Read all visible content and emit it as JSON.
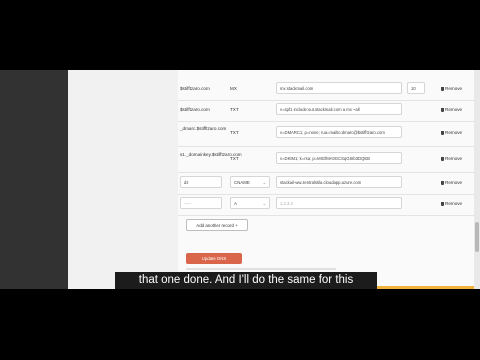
{
  "records": [
    {
      "host": "$stifftzaro.com",
      "type": "MX",
      "value": "mx.stackmail.com",
      "priority": "10",
      "remove": "Remove"
    },
    {
      "host": "$stifftzaro.com",
      "type": "TXT",
      "value": "v=spf1 include:out.stackmail.com a mx ~all",
      "remove": "Remove"
    },
    {
      "host": "_dmarc.$stifftzaro.com",
      "type": "TXT",
      "value": "v=DMARC1; p=none; rua=mailto:dmarc@$stifftzaro.com",
      "remove": "Remove"
    },
    {
      "host": "s1._domainkey.$stifftzaro.com",
      "type": "TXT",
      "value": "v=DKIM1; k=rsa; p=MIGfMA0GCSqGSIb3DQEB",
      "remove": "Remove"
    },
    {
      "host": "dz",
      "type": "CNAME",
      "value": "stackail-ww.zentralstila.cloudapp.azure.com",
      "remove": "Remove"
    },
    {
      "host": "-----",
      "type": "A",
      "value": "1.2.3.4",
      "remove": "Remove"
    }
  ],
  "add_record_label": "Add another record",
  "update_label": "Update DNS",
  "subtitle": "that one done. And I'll do the same for this",
  "colors": {
    "accent": "#d9664a",
    "sidebar": "#323232"
  }
}
